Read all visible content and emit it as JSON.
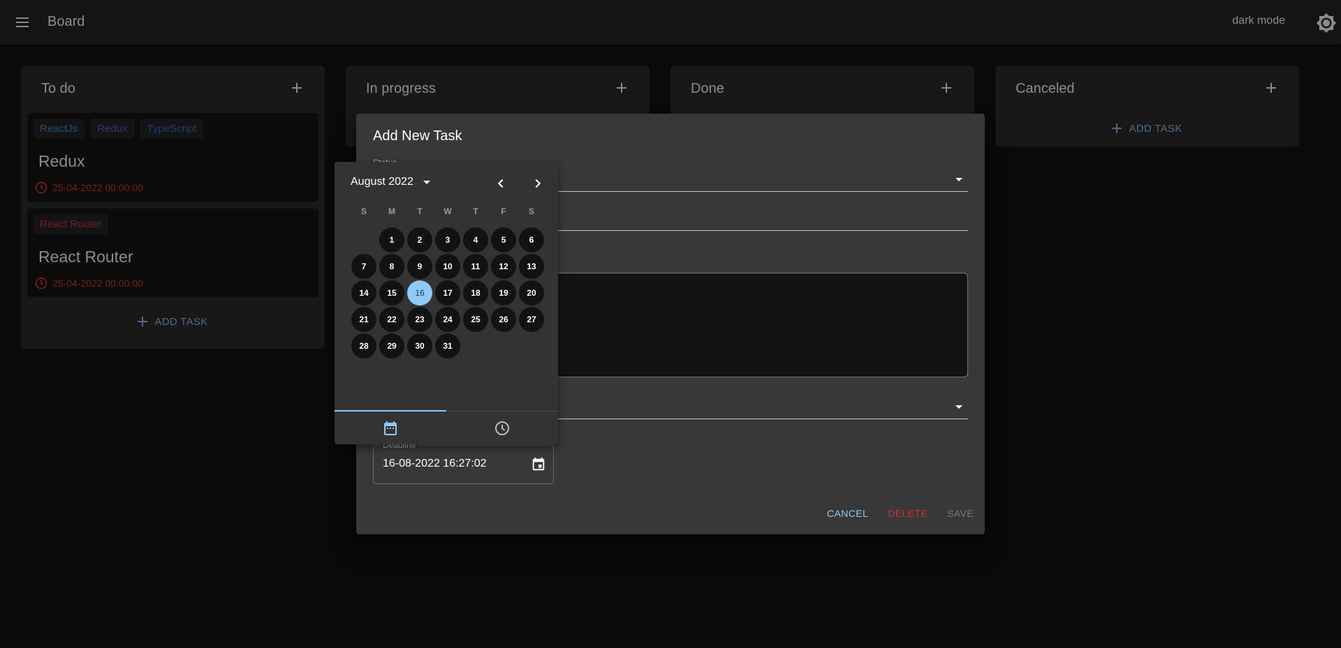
{
  "appbar": {
    "title": "Board",
    "mode_label": "dark mode",
    "menu_icon": "hamburger-menu-icon",
    "mode_icon": "brightness-icon"
  },
  "columns": [
    {
      "title": "To do",
      "cards": [
        {
          "tags": [
            {
              "label": "ReactJs",
              "color": "#1f4f7a"
            },
            {
              "label": "Redux",
              "color": "#4a2a7a"
            },
            {
              "label": "TypeScript",
              "color": "#1f3f6e"
            }
          ],
          "title": "Redux",
          "deadline": "25-04-2022 00:00:00"
        },
        {
          "tags": [
            {
              "label": "React Router",
              "color": "#7a1f1f"
            }
          ],
          "title": "React Router",
          "deadline": "25-04-2022 00:00:00"
        }
      ],
      "add_task_label": "ADD TASK"
    },
    {
      "title": "In progress",
      "cards": []
    },
    {
      "title": "Done",
      "cards": []
    },
    {
      "title": "Canceled",
      "cards": [],
      "add_task_label": "ADD TASK"
    }
  ],
  "dialog": {
    "title": "Add New Task",
    "status_label": "Status",
    "status_value": "",
    "title_value": "",
    "description_value": "",
    "priority_value": "",
    "deadline_label": "Deadline",
    "deadline_value": "16-08-2022 16:27:02",
    "actions": {
      "cancel": "CANCEL",
      "delete": "DELETE",
      "save": "SAVE"
    }
  },
  "picker": {
    "month_year": "August 2022",
    "weekdays": [
      "S",
      "M",
      "T",
      "W",
      "T",
      "F",
      "S"
    ],
    "leading_blanks": 1,
    "days_in_month": 31,
    "selected_day": 16,
    "tabs": [
      {
        "name": "date",
        "icon": "calendar-icon",
        "active": true
      },
      {
        "name": "time",
        "icon": "clock-icon",
        "active": false
      }
    ]
  },
  "colors": {
    "accent": "#90caf9",
    "danger": "#d32f2f",
    "deadline_overdue": "#7a1f1f"
  }
}
